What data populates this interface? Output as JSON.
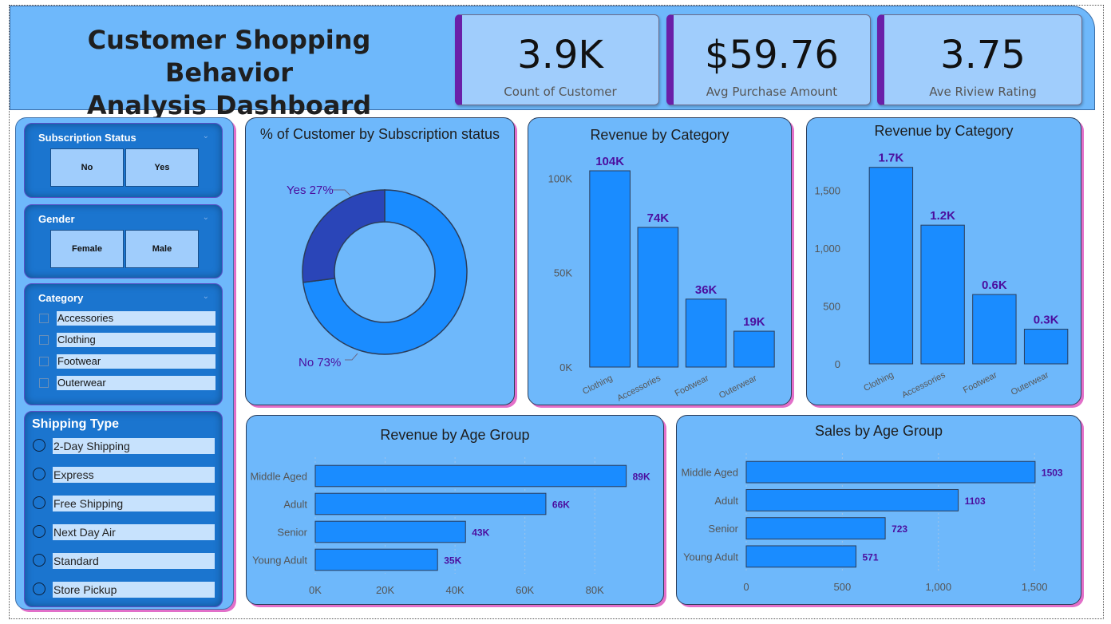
{
  "header": {
    "title_line1": "Customer Shopping Behavior",
    "title_line2": "Analysis Dashboard"
  },
  "kpis": [
    {
      "value": "3.9K",
      "label": "Count of Customer"
    },
    {
      "value": "$59.76",
      "label": "Avg Purchase Amount"
    },
    {
      "value": "3.75",
      "label": "Ave Riview Rating"
    }
  ],
  "slicers": {
    "subscription": {
      "title": "Subscription Status",
      "options": [
        "No",
        "Yes"
      ]
    },
    "gender": {
      "title": "Gender",
      "options": [
        "Female",
        "Male"
      ]
    },
    "category": {
      "title": "Category",
      "options": [
        "Accessories",
        "Clothing",
        "Footwear",
        "Outerwear"
      ]
    },
    "shipping": {
      "title": "Shipping Type",
      "options": [
        "2-Day Shipping",
        "Express",
        "Free Shipping",
        "Next Day Air",
        "Standard",
        "Store Pickup"
      ]
    }
  },
  "colors": {
    "bar": "#1a8cff",
    "donut_no": "#1a8cff",
    "donut_yes": "#2a45b8",
    "label": "#4b0e9e",
    "accent": "#6a1fa8"
  },
  "chart_data": [
    {
      "type": "pie",
      "title": "% of Customer by Subscription status",
      "hole": true,
      "categories": [
        "No",
        "Yes"
      ],
      "values": [
        73,
        27
      ],
      "data_labels": [
        "No 73%",
        "Yes 27%"
      ]
    },
    {
      "type": "bar",
      "title": "Revenue by Category",
      "categories": [
        "Clothing",
        "Accessories",
        "Footwear",
        "Outerwear"
      ],
      "values": [
        104000,
        74000,
        36000,
        19000
      ],
      "data_labels": [
        "104K",
        "74K",
        "36K",
        "19K"
      ],
      "ylim": [
        0,
        115000
      ],
      "yticks": [
        0,
        50000,
        100000
      ],
      "ytick_labels": [
        "0K",
        "50K",
        "100K"
      ]
    },
    {
      "type": "bar",
      "title": "Revenue by Category",
      "categories": [
        "Clothing",
        "Accessories",
        "Footwear",
        "Outerwear"
      ],
      "values": [
        1700,
        1200,
        600,
        300
      ],
      "data_labels": [
        "1.7K",
        "1.2K",
        "0.6K",
        "0.3K"
      ],
      "ylim": [
        0,
        1850
      ],
      "yticks": [
        0,
        500,
        1000,
        1500
      ],
      "ytick_labels": [
        "0",
        "500",
        "1,000",
        "1,500"
      ]
    },
    {
      "type": "bar",
      "orientation": "horizontal",
      "title": "Revenue by Age Group",
      "categories": [
        "Middle Aged",
        "Adult",
        "Senior",
        "Young Adult"
      ],
      "values": [
        89000,
        66000,
        43000,
        35000
      ],
      "data_labels": [
        "89K",
        "66K",
        "43K",
        "35K"
      ],
      "xlim": [
        0,
        90000
      ],
      "xticks": [
        0,
        20000,
        40000,
        60000,
        80000
      ],
      "xtick_labels": [
        "0K",
        "20K",
        "40K",
        "60K",
        "80K"
      ],
      "grid": true
    },
    {
      "type": "bar",
      "orientation": "horizontal",
      "title": "Sales by Age Group",
      "categories": [
        "Middle Aged",
        "Adult",
        "Senior",
        "Young Adult"
      ],
      "values": [
        1503,
        1103,
        723,
        571
      ],
      "data_labels": [
        "1503",
        "1103",
        "723",
        "571"
      ],
      "xlim": [
        0,
        1520
      ],
      "xticks": [
        0,
        500,
        1000,
        1500
      ],
      "xtick_labels": [
        "0",
        "500",
        "1,000",
        "1,500"
      ],
      "grid": true
    }
  ]
}
